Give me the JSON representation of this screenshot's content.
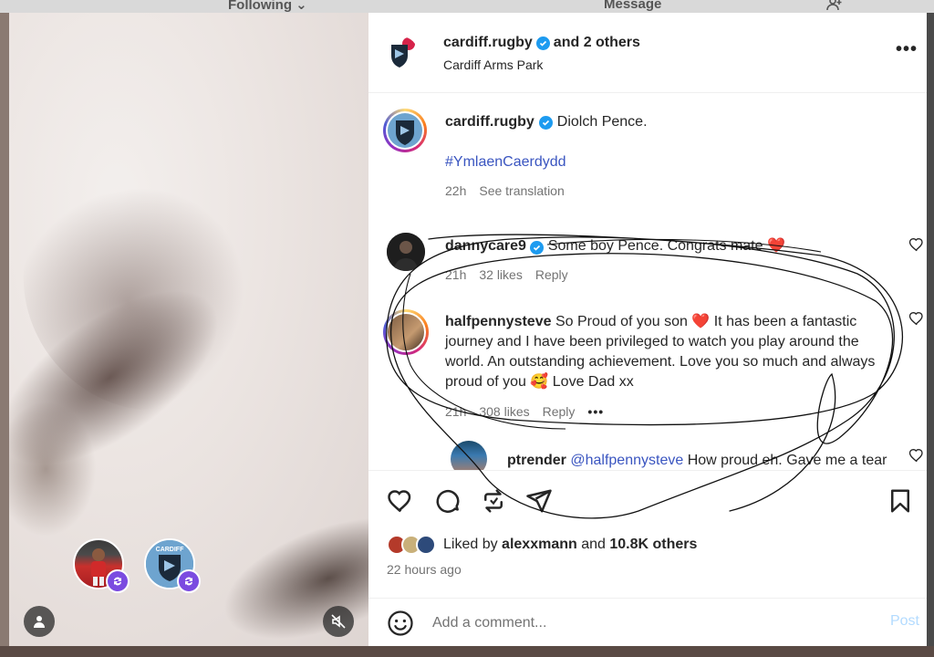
{
  "background": {
    "following_label": "Following ⌄",
    "message_label": "Message",
    "person_icon": "add-person-icon"
  },
  "media": {
    "collaborators": [
      {
        "icon": "player-avatar"
      },
      {
        "icon": "club-logo-avatar",
        "logo_text": "CARDIFF"
      }
    ],
    "badge_icon": "collab-refresh-icon",
    "tag_icon": "user-tag-icon",
    "mute_icon": "muted-speaker-icon"
  },
  "header": {
    "username": "cardiff.rugby",
    "others": "and 2 others",
    "location": "Cardiff Arms Park",
    "more_icon": "•••"
  },
  "caption": {
    "username": "cardiff.rugby",
    "text": "Diolch Pence.",
    "hashtag": "#YmlaenCaerdydd",
    "time": "22h",
    "see_translation": "See translation"
  },
  "comments": [
    {
      "username": "dannycare9",
      "text": "Some boy Pence. Congrats mate ❤️",
      "time": "21h",
      "likes": "32 likes",
      "reply": "Reply"
    },
    {
      "username": "halfpennysteve",
      "text": "So Proud of you son ❤️ It has been a fantastic journey and I have been privileged to watch you play around the world. An outstanding achievement. Love you so much and always proud of you 🥰 Love Dad xx",
      "time": "21h",
      "likes": "308 likes",
      "reply": "Reply",
      "more": "•••"
    },
    {
      "username": "ptrender",
      "mention": "@halfpennysteve",
      "text": "How proud eh. Gave me a tear that. Unbelievable player 🙈"
    }
  ],
  "actions": {
    "liked_by_prefix": "Liked by",
    "liked_by_user": "alexxmann",
    "liked_by_and": "and",
    "liked_by_others": "10.8K others",
    "time_ago": "22 hours ago"
  },
  "add_comment": {
    "placeholder": "Add a comment...",
    "post_label": "Post"
  },
  "colors": {
    "verified": "#1d9bf0",
    "link": "#3a55c0",
    "post_disabled": "#b3dbff",
    "heart_red": "#e0245e"
  }
}
